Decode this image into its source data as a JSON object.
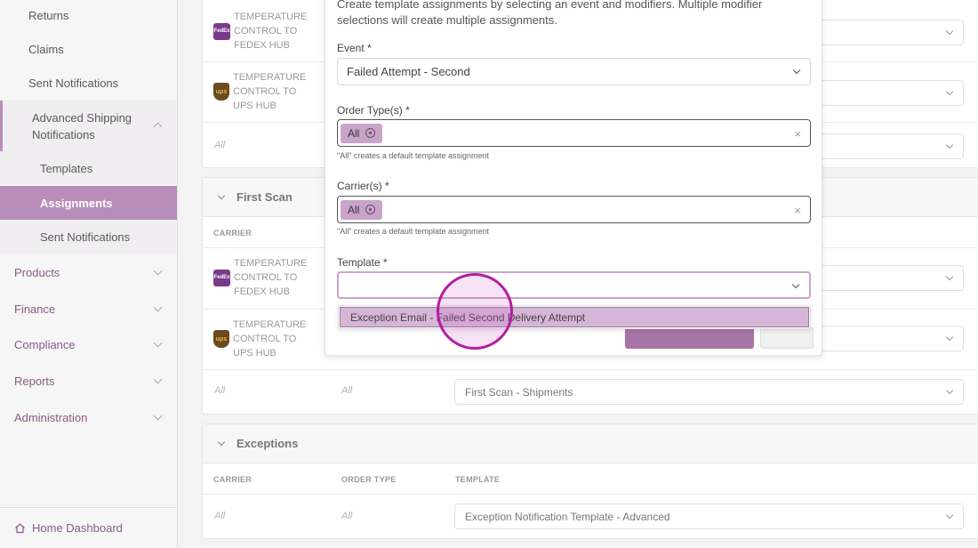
{
  "sidebar": {
    "items": [
      {
        "label": "Returns"
      },
      {
        "label": "Claims"
      },
      {
        "label": "Sent Notifications"
      },
      {
        "label": "Advanced Shipping Notifications"
      },
      {
        "label": "Templates"
      },
      {
        "label": "Assignments"
      },
      {
        "label": "Sent Notifications"
      },
      {
        "label": "Products"
      },
      {
        "label": "Finance"
      },
      {
        "label": "Compliance"
      },
      {
        "label": "Reports"
      },
      {
        "label": "Administration"
      }
    ],
    "home": "Home Dashboard"
  },
  "main": {
    "top_card": {
      "rows": [
        {
          "carrier": "TEMPERATURE CONTROL TO FEDEX HUB",
          "logo": "fedex-logo"
        },
        {
          "carrier": "TEMPERATURE CONTROL TO UPS HUB",
          "logo": "ups-logo"
        }
      ],
      "all_label": "All"
    },
    "first_scan": {
      "title": "First Scan",
      "col_carrier": "CARRIER",
      "rows": [
        {
          "carrier": "TEMPERATURE CONTROL TO FEDEX HUB"
        },
        {
          "carrier": "TEMPERATURE CONTROL TO UPS HUB"
        }
      ],
      "all_carrier": "All",
      "all_order": "All",
      "template": "First Scan - Shipments"
    },
    "exceptions": {
      "title": "Exceptions",
      "col_carrier": "CARRIER",
      "col_order": "ORDER TYPE",
      "col_template": "TEMPLATE",
      "all_carrier": "All",
      "all_order": "All",
      "template": "Exception Notification Template - Advanced"
    }
  },
  "modal": {
    "intro": "Create template assignments by selecting an event and modifiers. Multiple modifier selections will create multiple assignments.",
    "event_label": "Event *",
    "event_value": "Failed Attempt - Second",
    "order_label": "Order Type(s) *",
    "order_chip": "All",
    "order_hint": "\"All\" creates a default template assignment",
    "carrier_label": "Carrier(s) *",
    "carrier_chip": "All",
    "carrier_hint": "\"All\" creates a default template assignment",
    "template_label": "Template *",
    "template_value": "",
    "option": "Exception Email - Failed Second Delivery Attempt",
    "clear": "×"
  },
  "colors": {
    "accent": "#b98db9",
    "accent_dark": "#a774a7",
    "cursor": "#b01fa0"
  }
}
